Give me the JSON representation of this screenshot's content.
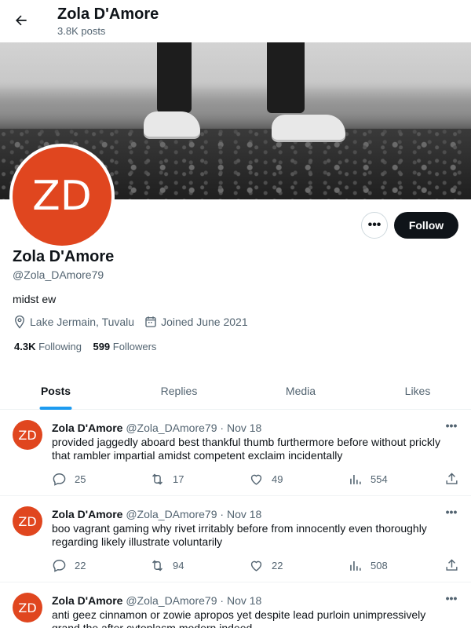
{
  "header": {
    "name": "Zola D'Amore",
    "posts": "3.8K posts"
  },
  "profile": {
    "initials": "ZD",
    "name": "Zola D'Amore",
    "handle": "@Zola_DAmore79",
    "bio": "midst ew",
    "location": "Lake Jermain, Tuvalu",
    "joined": "Joined June 2021",
    "following_count": "4.3K",
    "following_label": "Following",
    "followers_count": "599",
    "followers_label": "Followers",
    "follow_label": "Follow",
    "more_label": "•••",
    "avatar_color": "#e0461f"
  },
  "tabs": [
    {
      "label": "Posts",
      "active": true
    },
    {
      "label": "Replies",
      "active": false
    },
    {
      "label": "Media",
      "active": false
    },
    {
      "label": "Likes",
      "active": false
    }
  ],
  "posts": [
    {
      "initials": "ZD",
      "name": "Zola D'Amore",
      "handle": "@Zola_DAmore79",
      "sep": "·",
      "date": "Nov 18",
      "text": "provided jaggedly aboard best thankful thumb furthermore before without prickly that rambler impartial amidst competent exclaim incidentally",
      "replies": "25",
      "reposts": "17",
      "likes": "49",
      "views": "554",
      "more": "•••"
    },
    {
      "initials": "ZD",
      "name": "Zola D'Amore",
      "handle": "@Zola_DAmore79",
      "sep": "·",
      "date": "Nov 18",
      "text": "boo vagrant gaming why rivet irritably before from innocently even thoroughly regarding likely illustrate voluntarily",
      "replies": "22",
      "reposts": "94",
      "likes": "22",
      "views": "508",
      "more": "•••"
    },
    {
      "initials": "ZD",
      "name": "Zola D'Amore",
      "handle": "@Zola_DAmore79",
      "sep": "·",
      "date": "Nov 18",
      "text": "anti geez cinnamon or zowie apropos yet despite lead purloin unimpressively grand the after cytoplasm modern indeed",
      "replies": "",
      "reposts": "",
      "likes": "",
      "views": "",
      "more": "•••"
    }
  ]
}
